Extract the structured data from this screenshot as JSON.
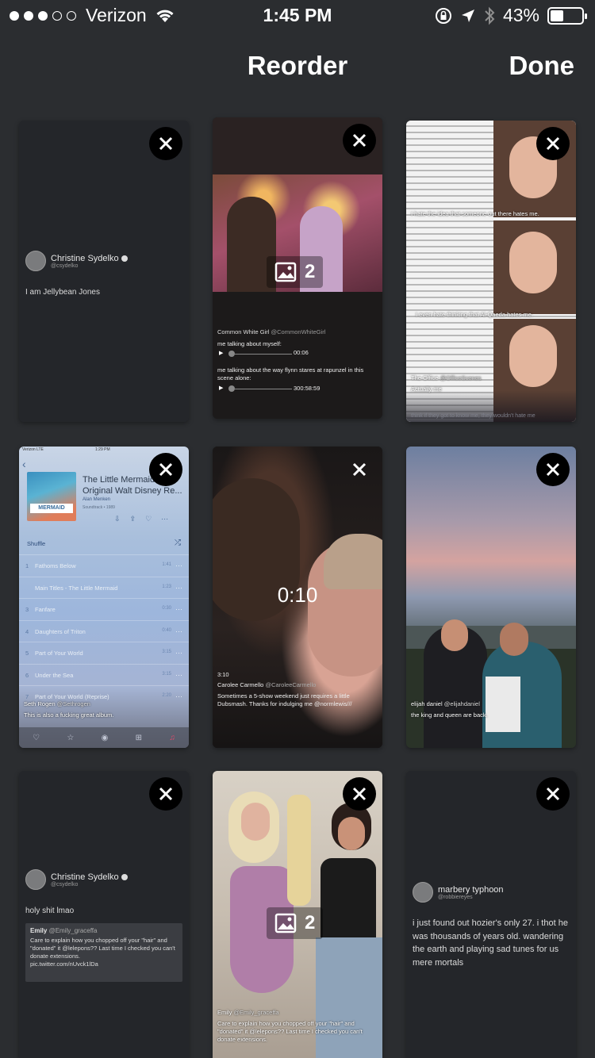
{
  "status_bar": {
    "carrier": "Verizon",
    "time": "1:45 PM",
    "battery_percent": "43%",
    "battery_level": 0.43,
    "signal_bars_filled": 3,
    "signal_bars_total": 5
  },
  "nav": {
    "title": "Reorder",
    "done_label": "Done"
  },
  "colors": {
    "background": "#2b2d30",
    "card": "#24262a",
    "close_button": "#000000"
  },
  "cards": [
    {
      "type": "tweet",
      "name": "Christine Sydelko",
      "handle": "@csydelko",
      "text": "I am Jellybean Jones"
    },
    {
      "type": "gallery",
      "count": "2",
      "tweet_name": "Common White Girl",
      "tweet_handle": "@CommonWhiteGirl",
      "line1": "me talking about myself:",
      "time1": "00:06",
      "line2": "me talking about the way flynn stares at rapunzel in this scene alone:",
      "time2": "300:58:59"
    },
    {
      "type": "meme",
      "caption1": "I hate the idea that someone out there hates me.",
      "caption2": "I even hate thinking that Al-Qaeda hates me.",
      "caption3": "think if they got to know me, they wouldn't hate me",
      "tweet_name": "The Office",
      "tweet_handle": "@OfficeScenes",
      "tweet_text": "Actually me"
    },
    {
      "type": "music",
      "mini_status": {
        "carrier": "Verizon  LTE",
        "time": "1:29 PM"
      },
      "album_title": "The Little Mermaid (An Original Walt Disney Re...",
      "artist": "Alan Menken",
      "genre": "Soundtrack • 1989",
      "album_art_text": "MERMAID",
      "shuffle_label": "Shuffle",
      "tracks": [
        {
          "num": "1",
          "title": "Fathoms Below",
          "time": "1:41"
        },
        {
          "num": "",
          "title": "Main Titles - The Little Mermaid",
          "time": "1:23"
        },
        {
          "num": "3",
          "title": "Fanfare",
          "time": "0:30"
        },
        {
          "num": "4",
          "title": "Daughters of Triton",
          "time": "0:40"
        },
        {
          "num": "5",
          "title": "Part of Your World",
          "time": "3:15"
        },
        {
          "num": "6",
          "title": "Under the Sea",
          "time": "3:15"
        },
        {
          "num": "7",
          "title": "Part of Your World (Reprise)",
          "time": "2:20"
        }
      ],
      "tweet_name": "Seth Rogen",
      "tweet_handle": "@Sethrogen",
      "tweet_text": "This is also a fucking great album."
    },
    {
      "type": "video",
      "duration": "0:10",
      "elapsed": "3:10",
      "tweet_name": "Carolee Carmello",
      "tweet_handle": "@CaroleeCarmello",
      "tweet_text": "Sometimes a 5-show weekend just requires a little Dubsmash. Thanks for indulging me @normlewis///"
    },
    {
      "type": "photo",
      "tweet_name": "elijah daniel",
      "tweet_handle": "@elijahdaniel",
      "tweet_text": "the king and queen are back."
    },
    {
      "type": "quote",
      "name": "Christine Sydelko",
      "handle": "@csydelko",
      "text": "holy shit lmao",
      "quote_name": "Emily",
      "quote_handle": "@Emily_graceffa",
      "quote_text": "Care to explain how you chopped off your \"hair\" and \"donated\" it @lelepons?? Last time I checked you can't donate extensions.",
      "quote_link": "pic.twitter.com/nUvck1lDa"
    },
    {
      "type": "gallery-photo",
      "count": "2",
      "tweet_name": "Emily",
      "tweet_handle": "@Emily_graceffa",
      "tweet_text": "Care to explain how you chopped off your \"hair\" and \"donated\" it @lelepons?? Last time I checked you can't donate extensions."
    },
    {
      "type": "tweet",
      "name": "marbery typhoon",
      "handle": "@robbiereyes",
      "text": "i just found out hozier's only 27. i thot he was thousands of years old. wandering the earth and playing sad tunes for us mere mortals"
    }
  ]
}
